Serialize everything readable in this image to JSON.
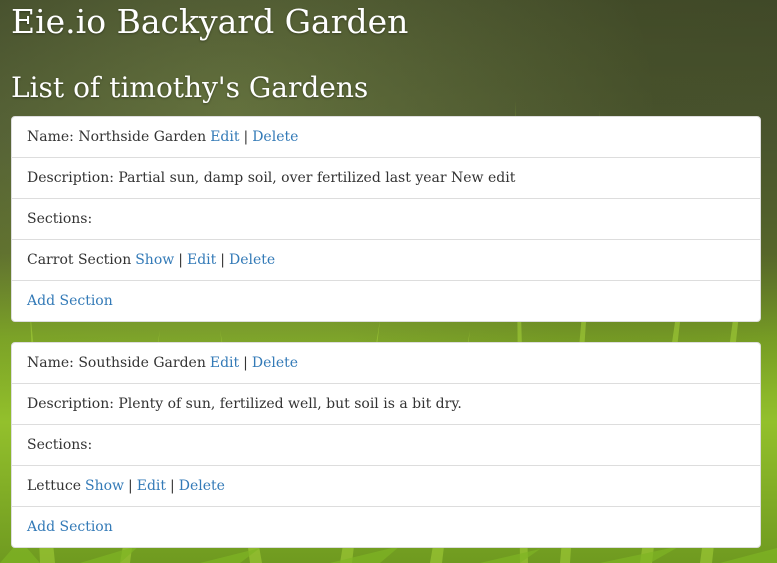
{
  "header": {
    "site_title": "Eie.io Backyard Garden",
    "list_title": "List of timothy's Gardens"
  },
  "separator": "|",
  "gardens": [
    {
      "name_text": "Name: Northside Garden",
      "edit_label": "Edit",
      "delete_label": "Delete",
      "description_text": "Description: Partial sun, damp soil, over fertilized last year New edit",
      "sections_label": "Sections:",
      "sections": [
        {
          "name": "Carrot Section",
          "show_label": "Show",
          "edit_label": "Edit",
          "delete_label": "Delete"
        }
      ],
      "add_section_label": "Add Section"
    },
    {
      "name_text": "Name: Southside Garden",
      "edit_label": "Edit",
      "delete_label": "Delete",
      "description_text": "Description: Plenty of sun, fertilized well, but soil is a bit dry.",
      "sections_label": "Sections:",
      "sections": [
        {
          "name": "Lettuce",
          "show_label": "Show",
          "edit_label": "Edit",
          "delete_label": "Delete"
        }
      ],
      "add_section_label": "Add Section"
    }
  ],
  "colors": {
    "link": "#337ab7",
    "text": "#333333",
    "card_bg": "#ffffff",
    "heading": "#ffffff"
  }
}
